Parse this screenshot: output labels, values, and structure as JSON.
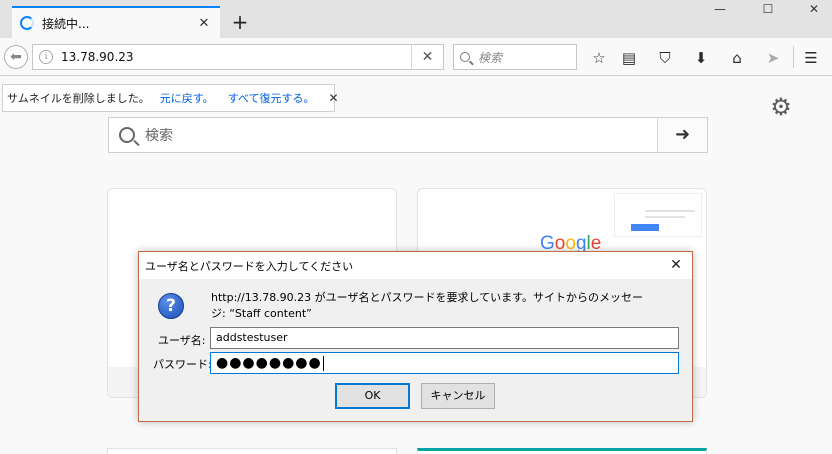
{
  "browser": {
    "tab_title": "接続中...",
    "new_tab": "+",
    "window_controls": {
      "minimize": "—",
      "maximize": "☐",
      "close": "✕"
    },
    "url": "13.78.90.23",
    "url_clear": "✕",
    "search_placeholder": "検索",
    "icons": [
      "back-arrow-icon",
      "info-icon",
      "star-icon",
      "reading-list-icon",
      "pocket-icon",
      "download-icon",
      "home-icon",
      "send-icon",
      "menu-icon",
      "gear-icon",
      "search-icon"
    ]
  },
  "notification": {
    "text": "サムネイルを削除しました。",
    "undo": "元に戻す。",
    "restore_all": "すべて復元する。",
    "close": "✕"
  },
  "page": {
    "search_placeholder": "検索",
    "go": "➜",
    "tiles": {
      "right_logo": "Google"
    }
  },
  "dialog": {
    "title": "ユーザ名とパスワードを入力してください",
    "close": "✕",
    "message": "http://13.78.90.23 がユーザ名とパスワードを要求しています。サイトからのメッセージ: “Staff content”",
    "username_label": "ユーザ名:",
    "username_value": "addstestuser",
    "password_label": "パスワード:",
    "password_value": "●●●●●●●●",
    "ok_label": "OK",
    "cancel_label": "キャンセル",
    "accent_color": "#0078d7"
  }
}
